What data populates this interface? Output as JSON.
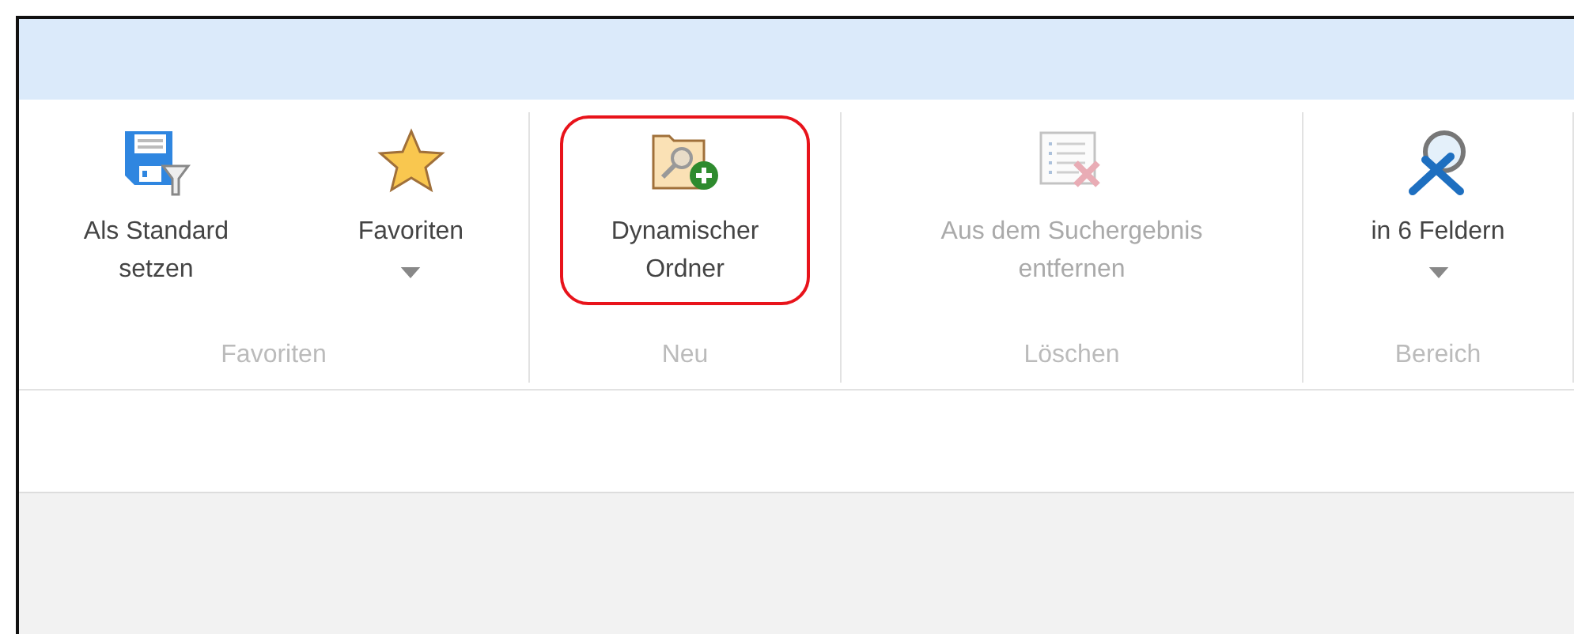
{
  "ribbon": {
    "groups": [
      {
        "name": "Favoriten",
        "buttons": [
          {
            "label": "Als Standard\nsetzen",
            "kind": "floppy-filter",
            "dropdown": false,
            "disabled": false,
            "highlighted": false
          },
          {
            "label": "Favoriten",
            "kind": "star",
            "dropdown": true,
            "disabled": false,
            "highlighted": false
          }
        ]
      },
      {
        "name": "Neu",
        "buttons": [
          {
            "label": "Dynamischer\nOrdner",
            "kind": "folder-search-add",
            "dropdown": false,
            "disabled": false,
            "highlighted": true
          }
        ]
      },
      {
        "name": "Löschen",
        "buttons": [
          {
            "label": "Aus dem Suchergebnis\nentfernen",
            "kind": "list-remove",
            "dropdown": false,
            "disabled": true,
            "highlighted": false
          }
        ]
      },
      {
        "name": "Bereich",
        "buttons": [
          {
            "label": "in 6 Feldern",
            "kind": "search-tools",
            "dropdown": true,
            "disabled": false,
            "highlighted": false
          }
        ]
      }
    ]
  }
}
